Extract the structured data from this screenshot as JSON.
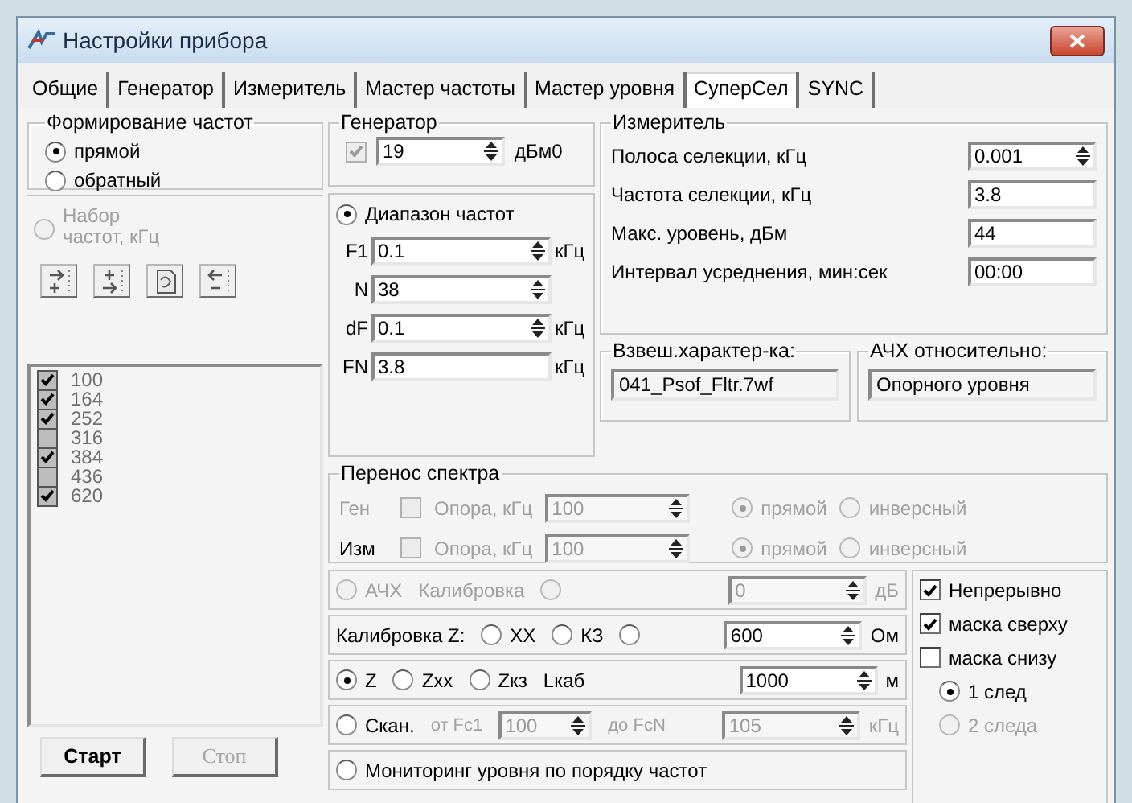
{
  "window": {
    "title": "Настройки прибора"
  },
  "tabs": [
    {
      "label": "Общие",
      "selected": false
    },
    {
      "label": "Генератор",
      "selected": false
    },
    {
      "label": "Измеритель",
      "selected": false
    },
    {
      "label": "Мастер частоты",
      "selected": false
    },
    {
      "label": "Мастер уровня",
      "selected": false
    },
    {
      "label": "СуперСел",
      "selected": true
    },
    {
      "label": "SYNC",
      "selected": false
    }
  ],
  "formation": {
    "title": "Формирование частот",
    "options": [
      {
        "label": "прямой",
        "selected": true
      },
      {
        "label": "обратный",
        "selected": false
      }
    ]
  },
  "freq_set": {
    "label": "Набор частот, кГц",
    "selected": false,
    "disabled": true,
    "items": [
      {
        "label": "100",
        "checked": true
      },
      {
        "label": "164",
        "checked": true
      },
      {
        "label": "252",
        "checked": true
      },
      {
        "label": "316",
        "checked": false
      },
      {
        "label": "384",
        "checked": true
      },
      {
        "label": "436",
        "checked": false
      },
      {
        "label": "620",
        "checked": true
      }
    ]
  },
  "buttons": [
    {
      "label": "Старт",
      "disabled": false
    },
    {
      "label": "Стоп",
      "disabled": true
    }
  ],
  "generator": {
    "title": "Генератор",
    "enabled": {
      "checked": true,
      "disabled": true
    },
    "value": "19",
    "unit": "дБм0"
  },
  "range": {
    "label": "Диапазон частот",
    "selected": true,
    "fields": [
      {
        "label": "F1",
        "value": "0.1",
        "unit": "кГц",
        "spinner": true
      },
      {
        "label": "N",
        "value": "38",
        "spinner": true
      },
      {
        "label": "dF",
        "value": "0.1",
        "unit": "кГц",
        "spinner": true
      },
      {
        "label": "FN",
        "value": "3.8",
        "unit": "кГц",
        "spinner": false
      }
    ]
  },
  "meter": {
    "title": "Измеритель",
    "fields": [
      {
        "label": "Полоса селекции, кГц",
        "value": "0.001",
        "spinner": true
      },
      {
        "label": "Частота селекции, кГц",
        "value": "3.8",
        "spinner": false
      },
      {
        "label": "Макс. уровень, дБм",
        "value": "44",
        "spinner": false
      },
      {
        "label": "Интервал усреднения, мин:сек",
        "value": "00:00",
        "spinner": false
      }
    ]
  },
  "weighting": {
    "title": "Взвеш.характер-ка:",
    "value": "041_Psof_Fltr.7wf"
  },
  "afc_relative": {
    "title": "АЧХ относительно:",
    "value": "Опорного уровня"
  },
  "spectrum_shift": {
    "title": "Перенос спектра",
    "rows": [
      {
        "label": "Ген",
        "label_disabled": true,
        "reference": {
          "label": "Опора, кГц",
          "checked": false,
          "disabled": true
        },
        "value": "100",
        "modes": [
          {
            "label": "прямой",
            "selected": true,
            "disabled": true
          },
          {
            "label": "инверсный",
            "selected": false,
            "disabled": true
          }
        ]
      },
      {
        "label": "Изм",
        "label_disabled": false,
        "reference": {
          "label": "Опора, кГц",
          "checked": false,
          "disabled": true
        },
        "value": "100",
        "modes": [
          {
            "label": "прямой",
            "selected": true,
            "disabled": true
          },
          {
            "label": "инверсный",
            "selected": false,
            "disabled": true
          }
        ]
      }
    ]
  },
  "mode_rows": [
    {
      "items": [
        {
          "kind": "radio",
          "label": "АЧХ",
          "selected": false,
          "disabled": true
        },
        {
          "kind": "text",
          "label": "Калибровка",
          "disabled": true
        },
        {
          "kind": "radio",
          "selected": false,
          "disabled": true
        }
      ],
      "field": {
        "value": "0",
        "unit": "дБ",
        "disabled": true
      }
    },
    {
      "items": [
        {
          "kind": "text",
          "label": "Калибровка Z:",
          "disabled": false
        },
        {
          "kind": "radio",
          "label": "XX",
          "selected": false,
          "disabled": false
        },
        {
          "kind": "radio",
          "label": "КЗ",
          "selected": false,
          "disabled": false
        },
        {
          "kind": "radio",
          "selected": false,
          "disabled": false
        }
      ],
      "field": {
        "value": "600",
        "unit": "Ом",
        "disabled": false
      }
    },
    {
      "items": [
        {
          "kind": "radio",
          "label": "Z",
          "selected": true,
          "disabled": false
        },
        {
          "kind": "radio",
          "label": "Zxx",
          "selected": false,
          "disabled": false
        },
        {
          "kind": "radio",
          "label": "Zкз",
          "selected": false,
          "disabled": false
        },
        {
          "kind": "text",
          "label": "Lкаб",
          "disabled": false
        }
      ],
      "field": {
        "value": "1000",
        "unit": "м",
        "disabled": false
      }
    },
    {
      "items": [
        {
          "kind": "radio",
          "label": "Скан.",
          "selected": false,
          "disabled": false
        },
        {
          "kind": "text",
          "label": "от Fc1",
          "disabled": true,
          "small": true
        },
        {
          "kind": "spin",
          "value": "100",
          "disabled": true
        },
        {
          "kind": "text",
          "label": "до FcN",
          "disabled": true,
          "small": true
        }
      ],
      "field": {
        "value": "105",
        "unit": "кГц",
        "disabled": true
      }
    },
    {
      "items": [
        {
          "kind": "radio",
          "label": "Мониторинг  уровня по порядку частот",
          "selected": false,
          "disabled": false
        }
      ]
    }
  ],
  "display_options": [
    {
      "kind": "checkbox",
      "label": "Непрерывно",
      "checked": true,
      "disabled": false
    },
    {
      "kind": "checkbox",
      "label": "маска сверху",
      "checked": true,
      "disabled": false
    },
    {
      "kind": "checkbox",
      "label": "маска снизу",
      "checked": false,
      "disabled": false
    },
    {
      "kind": "radio",
      "label": "1 след",
      "selected": true,
      "disabled": false
    },
    {
      "kind": "radio",
      "label": "2 следа",
      "selected": false,
      "disabled": true
    }
  ]
}
